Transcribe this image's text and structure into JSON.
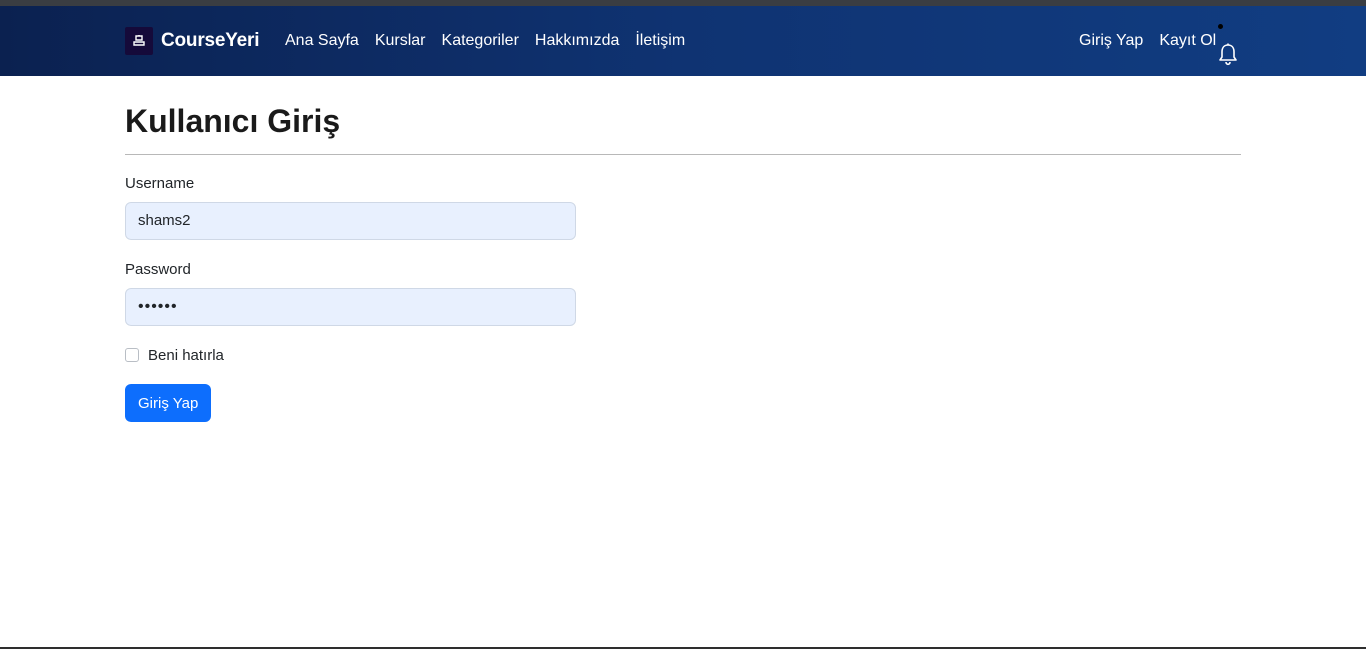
{
  "navbar": {
    "brand": "CourseYeri",
    "brand_icon": "graduation-icon",
    "links": [
      "Ana Sayfa",
      "Kurslar",
      "Kategoriler",
      "Hakkımızda",
      "İletişim"
    ],
    "login_link": "Giriş Yap",
    "register_link": "Kayıt Ol",
    "notification_icon": "bell-icon"
  },
  "page": {
    "title": "Kullanıcı Giriş"
  },
  "form": {
    "username_label": "Username",
    "username_value": "shams2",
    "password_label": "Password",
    "password_value": "••••••",
    "remember_label": "Beni hatırla",
    "remember_checked": false,
    "submit_label": "Giriş Yap"
  },
  "colors": {
    "navbar_start": "#0b2150",
    "navbar_end": "#113d82",
    "primary_button": "#0d6efd",
    "input_bg": "#e8f0fe"
  }
}
